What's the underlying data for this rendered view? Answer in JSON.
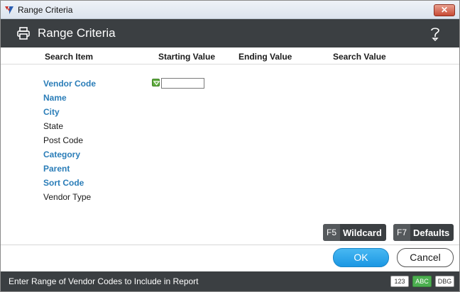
{
  "window": {
    "title": "Range Criteria"
  },
  "header": {
    "title": "Range Criteria"
  },
  "columns": [
    "Search Item",
    "Starting Value",
    "Ending Value",
    "Search Value"
  ],
  "criteria": [
    {
      "label": "Vendor Code",
      "style": "link"
    },
    {
      "label": "Name",
      "style": "link"
    },
    {
      "label": "City",
      "style": "link"
    },
    {
      "label": "State",
      "style": "plain"
    },
    {
      "label": "Post Code",
      "style": "plain"
    },
    {
      "label": "Category",
      "style": "link"
    },
    {
      "label": "Parent",
      "style": "link"
    },
    {
      "label": "Sort Code",
      "style": "link"
    },
    {
      "label": "Vendor Type",
      "style": "plain"
    }
  ],
  "range_input": {
    "value": ""
  },
  "function_keys": {
    "wildcard": {
      "key": "F5",
      "label": "Wildcard"
    },
    "defaults": {
      "key": "F7",
      "label": "Defaults"
    }
  },
  "buttons": {
    "ok": "OK",
    "cancel": "Cancel"
  },
  "status": {
    "message": "Enter Range of Vendor Codes to Include in Report",
    "badges": [
      "123",
      "ABC",
      "DBG"
    ]
  },
  "colors": {
    "header_bg": "#3b3f42",
    "link_text": "#2a7db8",
    "ok_button": "#1b97e3",
    "abc_badge": "#4caf50"
  }
}
